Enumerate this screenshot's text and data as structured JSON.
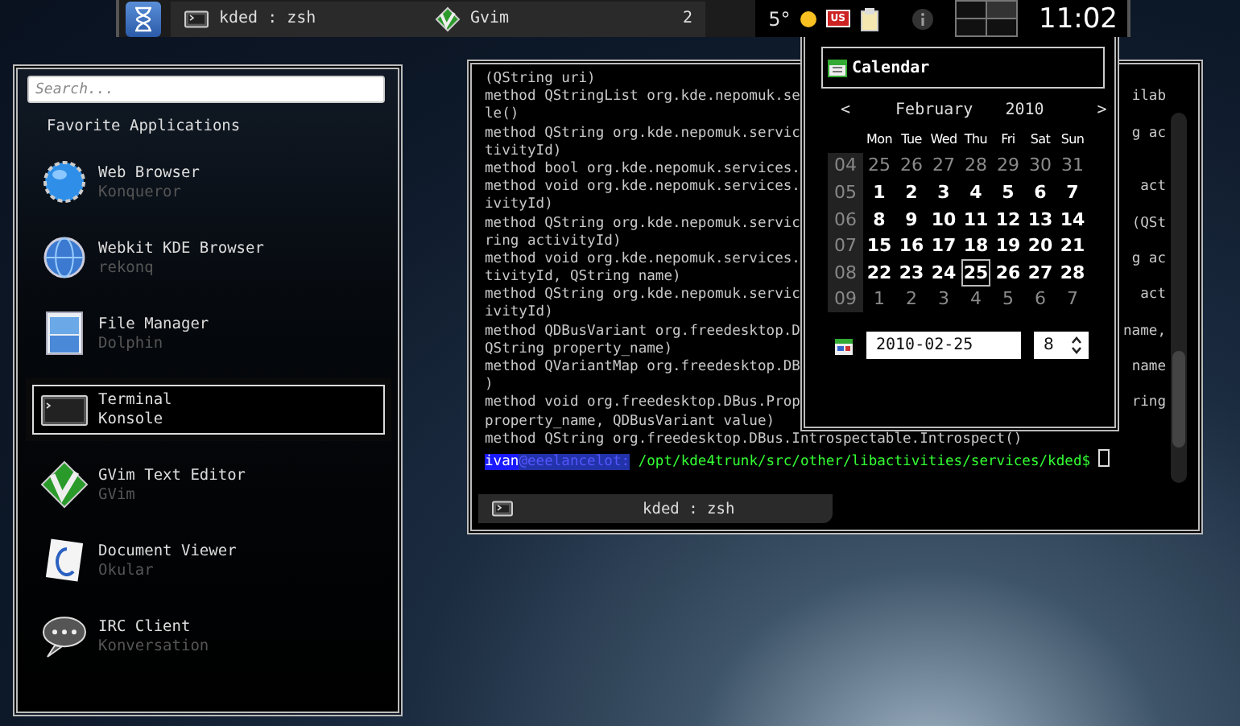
{
  "taskbar": {
    "tasks": [
      {
        "kind": "terminal",
        "label": "kded : zsh"
      },
      {
        "kind": "vim",
        "label": "Gvim",
        "count": "2"
      }
    ],
    "weather": {
      "temperature": "5°"
    },
    "keyboard_layout": "US",
    "clock": "11:02"
  },
  "launcher": {
    "search": {
      "placeholder": "Search..."
    },
    "section": "Favorite Applications",
    "items": [
      {
        "kind": "globe",
        "name": "Web Browser",
        "subtitle": "Konqueror",
        "selected": false
      },
      {
        "kind": "webkit",
        "name": "Webkit KDE Browser",
        "subtitle": "rekonq",
        "selected": false
      },
      {
        "kind": "files",
        "name": "File Manager",
        "subtitle": "Dolphin",
        "selected": false
      },
      {
        "kind": "terminal",
        "name": "Terminal",
        "subtitle": "Konsole",
        "selected": true
      },
      {
        "kind": "vim",
        "name": "GVim Text Editor",
        "subtitle": "GVim",
        "selected": false
      },
      {
        "kind": "document",
        "name": "Document Viewer",
        "subtitle": "Okular",
        "selected": false
      },
      {
        "kind": "chat",
        "name": "IRC Client",
        "subtitle": "Konversation",
        "selected": false
      }
    ]
  },
  "terminal": {
    "lines": [
      {
        "text": "(QString uri)"
      },
      {
        "text": "method QStringList org.kde.nepomuk.se",
        "right": "ilab"
      },
      {
        "text": "le()"
      },
      {
        "text": "method QString org.kde.nepomuk.servic",
        "right": "g ac"
      },
      {
        "text": "tivityId)"
      },
      {
        "text": "method bool org.kde.nepomuk.services."
      },
      {
        "text": "method void org.kde.nepomuk.services.",
        "right": "act"
      },
      {
        "text": "ivityId)"
      },
      {
        "text": "method QString org.kde.nepomuk.servic",
        "right": "(QSt"
      },
      {
        "text": "ring activityId)"
      },
      {
        "text": "method void org.kde.nepomuk.services.",
        "right": "g ac"
      },
      {
        "text": "tivityId, QString name)"
      },
      {
        "text": "method QString org.kde.nepomuk.servic",
        "right": "act"
      },
      {
        "text": "ivityId)"
      },
      {
        "text": "method QDBusVariant org.freedesktop.D",
        "right": "name,"
      },
      {
        "text": "QString property_name)"
      },
      {
        "text": "method QVariantMap org.freedesktop.DB",
        "right": "name"
      },
      {
        "text": ")"
      },
      {
        "text": "method void org.freedesktop.DBus.Prop",
        "right": "ring"
      },
      {
        "text": "property_name, QDBusVariant value)"
      },
      {
        "text": "method QString org.freedesktop.DBus.Introspectable.Introspect()"
      }
    ],
    "prompt": {
      "user": "ivan",
      "host": "@eeelancelot:",
      "path": " /opt/kde4trunk/src/other/libactivities/services/kded$"
    },
    "tab": "kded : zsh"
  },
  "calendar": {
    "title": "Calendar",
    "prev": "<",
    "month": "February",
    "year": "2010",
    "next": ">",
    "weekdays": [
      "Mon",
      "Tue",
      "Wed",
      "Thu",
      "Fri",
      "Sat",
      "Sun"
    ],
    "weeks": [
      {
        "number": "04",
        "days": [
          {
            "day": "25",
            "current_month": false,
            "selected": false
          },
          {
            "day": "26",
            "current_month": false,
            "selected": false
          },
          {
            "day": "27",
            "current_month": false,
            "selected": false
          },
          {
            "day": "28",
            "current_month": false,
            "selected": false
          },
          {
            "day": "29",
            "current_month": false,
            "selected": false
          },
          {
            "day": "30",
            "current_month": false,
            "selected": false
          },
          {
            "day": "31",
            "current_month": false,
            "selected": false
          }
        ]
      },
      {
        "number": "05",
        "days": [
          {
            "day": "1",
            "current_month": true,
            "selected": false
          },
          {
            "day": "2",
            "current_month": true,
            "selected": false
          },
          {
            "day": "3",
            "current_month": true,
            "selected": false
          },
          {
            "day": "4",
            "current_month": true,
            "selected": false
          },
          {
            "day": "5",
            "current_month": true,
            "selected": false
          },
          {
            "day": "6",
            "current_month": true,
            "selected": false
          },
          {
            "day": "7",
            "current_month": true,
            "selected": false
          }
        ]
      },
      {
        "number": "06",
        "days": [
          {
            "day": "8",
            "current_month": true,
            "selected": false
          },
          {
            "day": "9",
            "current_month": true,
            "selected": false
          },
          {
            "day": "10",
            "current_month": true,
            "selected": false
          },
          {
            "day": "11",
            "current_month": true,
            "selected": false
          },
          {
            "day": "12",
            "current_month": true,
            "selected": false
          },
          {
            "day": "13",
            "current_month": true,
            "selected": false
          },
          {
            "day": "14",
            "current_month": true,
            "selected": false
          }
        ]
      },
      {
        "number": "07",
        "days": [
          {
            "day": "15",
            "current_month": true,
            "selected": false
          },
          {
            "day": "16",
            "current_month": true,
            "selected": false
          },
          {
            "day": "17",
            "current_month": true,
            "selected": false
          },
          {
            "day": "18",
            "current_month": true,
            "selected": false
          },
          {
            "day": "19",
            "current_month": true,
            "selected": false
          },
          {
            "day": "20",
            "current_month": true,
            "selected": false
          },
          {
            "day": "21",
            "current_month": true,
            "selected": false
          }
        ]
      },
      {
        "number": "08",
        "days": [
          {
            "day": "22",
            "current_month": true,
            "selected": false
          },
          {
            "day": "23",
            "current_month": true,
            "selected": false
          },
          {
            "day": "24",
            "current_month": true,
            "selected": false
          },
          {
            "day": "25",
            "current_month": true,
            "selected": true
          },
          {
            "day": "26",
            "current_month": true,
            "selected": false
          },
          {
            "day": "27",
            "current_month": true,
            "selected": false
          },
          {
            "day": "28",
            "current_month": true,
            "selected": false
          }
        ]
      },
      {
        "number": "09",
        "days": [
          {
            "day": "1",
            "current_month": false,
            "selected": false
          },
          {
            "day": "2",
            "current_month": false,
            "selected": false
          },
          {
            "day": "3",
            "current_month": false,
            "selected": false
          },
          {
            "day": "4",
            "current_month": false,
            "selected": false
          },
          {
            "day": "5",
            "current_month": false,
            "selected": false
          },
          {
            "day": "6",
            "current_month": false,
            "selected": false
          },
          {
            "day": "7",
            "current_month": false,
            "selected": false
          }
        ]
      }
    ],
    "date": "2010-02-25",
    "week": "8"
  }
}
